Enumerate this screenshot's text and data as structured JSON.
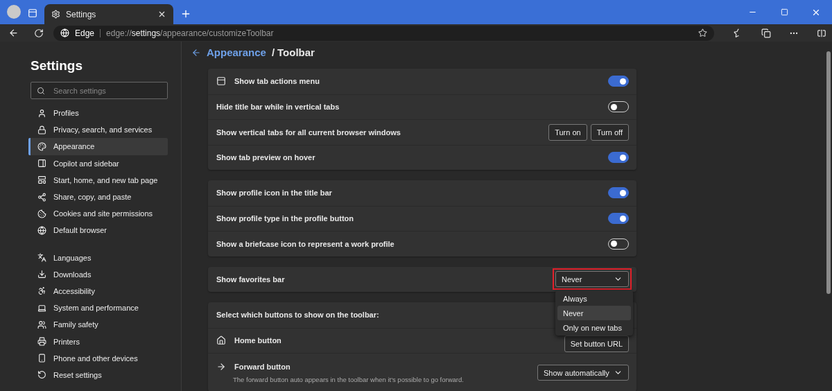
{
  "browser": {
    "tab_title": "Settings",
    "site_label": "Edge",
    "url": "edge://**settings**/appearance/customizeToolbar"
  },
  "sidebar": {
    "title": "Settings",
    "search_placeholder": "Search settings",
    "groups": [
      [
        {
          "label": "Profiles",
          "selected": false
        },
        {
          "label": "Privacy, search, and services",
          "selected": false
        },
        {
          "label": "Appearance",
          "selected": true
        },
        {
          "label": "Copilot and sidebar",
          "selected": false
        },
        {
          "label": "Start, home, and new tab page",
          "selected": false
        },
        {
          "label": "Share, copy, and paste",
          "selected": false
        },
        {
          "label": "Cookies and site permissions",
          "selected": false
        },
        {
          "label": "Default browser",
          "selected": false
        }
      ],
      [
        {
          "label": "Languages",
          "selected": false
        },
        {
          "label": "Downloads",
          "selected": false
        },
        {
          "label": "Accessibility",
          "selected": false
        },
        {
          "label": "System and performance",
          "selected": false
        },
        {
          "label": "Family safety",
          "selected": false
        },
        {
          "label": "Printers",
          "selected": false
        },
        {
          "label": "Phone and other devices",
          "selected": false
        },
        {
          "label": "Reset settings",
          "selected": false
        }
      ]
    ]
  },
  "breadcrumb": {
    "parent": "Appearance",
    "separator": "/",
    "current": "Toolbar"
  },
  "cards": [
    {
      "rows": [
        {
          "kind": "toggle",
          "label": "Show tab actions menu",
          "icon": true,
          "on": true
        },
        {
          "kind": "toggle",
          "label": "Hide title bar while in vertical tabs",
          "on": false
        },
        {
          "kind": "buttons",
          "label": "Show vertical tabs for all current browser windows",
          "buttons": [
            "Turn on",
            "Turn off"
          ]
        },
        {
          "kind": "toggle",
          "label": "Show tab preview on hover",
          "on": true
        }
      ]
    },
    {
      "rows": [
        {
          "kind": "toggle",
          "label": "Show profile icon in the title bar",
          "on": true
        },
        {
          "kind": "toggle",
          "label": "Show profile type in the profile button",
          "on": true
        },
        {
          "kind": "toggle",
          "label": "Show a briefcase icon to represent a work profile",
          "on": false
        }
      ]
    },
    {
      "rows": [
        {
          "kind": "dropdown",
          "label": "Show favorites bar",
          "value": "Never",
          "highlighted": true,
          "open": true,
          "options": [
            {
              "label": "Always",
              "selected": false
            },
            {
              "label": "Never",
              "selected": true
            },
            {
              "label": "Only on new tabs",
              "selected": false
            }
          ]
        }
      ]
    },
    {
      "rows": [
        {
          "kind": "heading",
          "label": "Select which buttons to show on the toolbar:"
        },
        {
          "kind": "buttons",
          "label": "Home button",
          "icon": true,
          "buttons": [
            "Set button URL"
          ]
        },
        {
          "kind": "select",
          "label": "Forward button",
          "icon": true,
          "value": "Show automatically",
          "description": "The forward button auto appears in the toolbar when it's possible to go forward."
        }
      ]
    }
  ]
}
